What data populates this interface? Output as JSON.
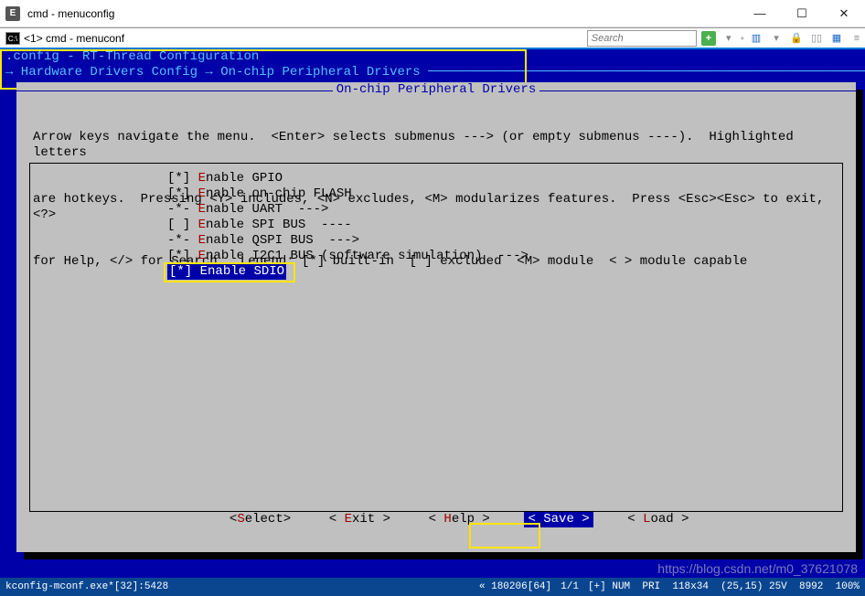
{
  "window": {
    "title": "cmd - menuconfig",
    "icon_label": "E"
  },
  "tab": {
    "icon_label": "C:\\",
    "label": "<1> cmd - menuconf"
  },
  "toolbar": {
    "search_placeholder": "Search",
    "add_label": "+",
    "dropdown_label": "▾"
  },
  "config": {
    "header1": ".config - RT-Thread Configuration",
    "breadcrumb": "→ Hardware Drivers Config → On-chip Peripheral Drivers ───────────────────────────────────────────────────────────────",
    "panel_title": " On-chip Peripheral Drivers ",
    "help_lines": [
      "Arrow keys navigate the menu.  <Enter> selects submenus ---> (or empty submenus ----).  Highlighted letters",
      "are hotkeys.  Pressing <Y> includes, <N> excludes, <M> modularizes features.  Press <Esc><Esc> to exit, <?>",
      "for Help, </> for Search.  Legend: [*] built-in  [ ] excluded  <M> module  < > module capable"
    ],
    "items": [
      {
        "mark": "[*]",
        "hot": "E",
        "rest": "nable GPIO"
      },
      {
        "mark": "[*]",
        "hot": "E",
        "rest": "nable on-chip FLASH"
      },
      {
        "mark": "-*-",
        "hot": "E",
        "rest": "nable UART  --->"
      },
      {
        "mark": "[ ]",
        "hot": "E",
        "rest": "nable SPI BUS  ----"
      },
      {
        "mark": "-*-",
        "hot": "E",
        "rest": "nable QSPI BUS  --->"
      },
      {
        "mark": "[*]",
        "hot": "E",
        "rest": "nable I2C1 BUS (software simulation)  --->"
      },
      {
        "mark": "[*]",
        "hot": "E",
        "rest": "nable SDIO",
        "selected": true
      }
    ],
    "buttons": {
      "select": "Select",
      "exit": "Exit",
      "help": "Help",
      "save": "Save",
      "load": "Load"
    }
  },
  "status": {
    "left": "kconfig-mconf.exe*[32]:5428",
    "hist": "« 180206[64]",
    "ln": "1/1",
    "misc": "[+] NUM  PRI  118x34  (25,15) 25V  8992  100%"
  },
  "watermark": "https://blog.csdn.net/m0_37621078"
}
